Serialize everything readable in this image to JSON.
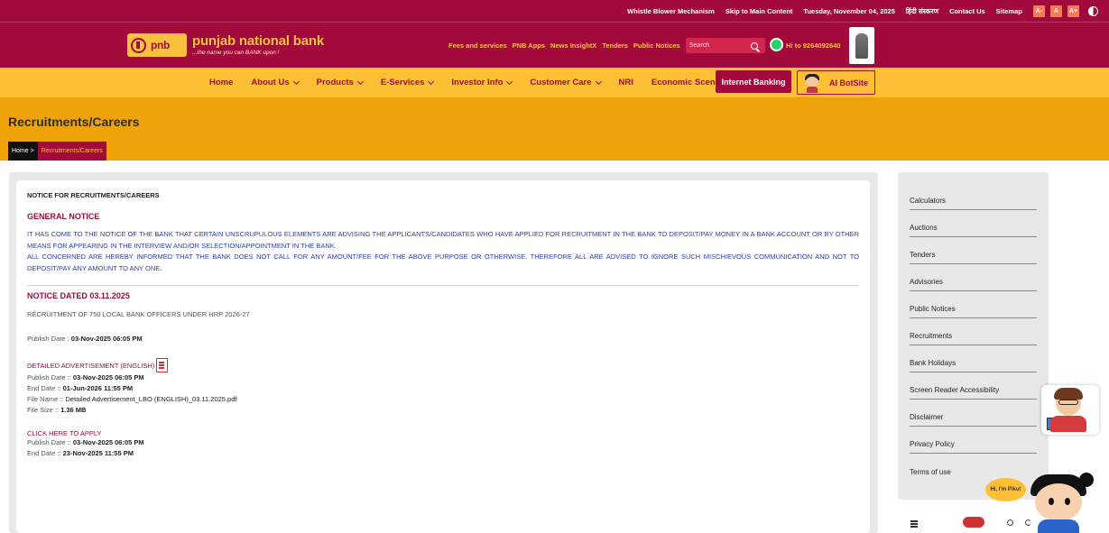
{
  "topbar": {
    "links": [
      "Whistle Blower Mechanism",
      "Skip to Main Content",
      "Tuesday, November 04, 2025",
      "हिंदी संस्करण",
      "Contact Us",
      "Sitemap"
    ],
    "font_sizes": [
      "A-",
      "A",
      "A+"
    ]
  },
  "header": {
    "logo_text": "pnb",
    "bank_name": "punjab national bank",
    "tagline": "...the name you can BANK upon !",
    "links": [
      "Fees and services",
      "PNB Apps",
      "News InsightX",
      "Tenders",
      "Public Notices"
    ],
    "search_placeholder": "Search",
    "whatsapp_text": "Hi to 9264092640"
  },
  "nav": {
    "items": [
      {
        "label": "Home",
        "dropdown": false
      },
      {
        "label": "About Us",
        "dropdown": true
      },
      {
        "label": "Products",
        "dropdown": true
      },
      {
        "label": "E-Services",
        "dropdown": true
      },
      {
        "label": "Investor Info",
        "dropdown": true
      },
      {
        "label": "Customer Care",
        "dropdown": true
      },
      {
        "label": "NRI",
        "dropdown": false
      },
      {
        "label": "Economic Scenario",
        "dropdown": false
      }
    ],
    "internet_banking": "Internet Banking",
    "ai_botsite": "AI BotSite"
  },
  "page": {
    "title": "Recruitments/Careers",
    "breadcrumb_home": "Home >",
    "breadcrumb_current": "Recruitments/Careers"
  },
  "content": {
    "notice_heading": "NOTICE FOR RECRUITMENTS/CAREERS",
    "general_title": "GENERAL NOTICE",
    "general_para1": "IT HAS COME TO THE NOTICE OF THE BANK THAT CERTAIN UNSCRUPULOUS ELEMENTS ARE ADVISING THE APPLICANTS/CANDIDATES WHO HAVE APPLIED FOR RECRUITMENT IN THE BANK TO DEPOSIT/PAY MONEY IN A BANK ACCOUNT OR BY OTHER MEANS FOR APPEARING IN THE INTERVIEW AND/OR SELECTION/APPOINTMENT IN THE BANK.",
    "general_para2": "ALL CONCERNED ARE HEREBY INFORMED THAT THE BANK DOES NOT CALL FOR ANY AMOUNT/FEE FOR THE ABOVE PURPOSE OR OTHERWISE. THEREFORE ALL ARE ADVISED TO IGNORE SUCH MISCHIEVOUS COMMUNICATION AND NOT TO DEPOSIT/PAY ANY AMOUNT TO ANY ONE.",
    "notice_dated": "NOTICE DATED 03.11.2025",
    "recruitment_title": "RECRUITMENT OF 750 LOCAL BANK OFFICERS UNDER HRP 2026-27",
    "publish_label": "Publish Date : ",
    "publish_value": "03-Nov-2025 06:05 PM",
    "advertisement": {
      "link": "DETAILED ADVERTISEMENT (ENGLISH)",
      "publish_label": "Publish Date :: ",
      "publish_value": "03-Nov-2025 06:05 PM",
      "end_label": "End Date :: ",
      "end_value": "01-Jun-2026 11:55 PM",
      "file_name_label": "File Name :: ",
      "file_name_value": "Detailed Advertisement_LBO (ENGLISH)_03.11.2025.pdf",
      "file_size_label": "File Size :: ",
      "file_size_value": "1.36 MB"
    },
    "apply": {
      "link": "CLICK HERE TO APPLY",
      "publish_label": "Publish Date :: ",
      "publish_value": "03-Nov-2025 06:05 PM",
      "end_label": "End Date :: ",
      "end_value": "23-Nov-2025 11:55 PM"
    }
  },
  "sidebar": {
    "items": [
      "Calculators",
      "Auctions",
      "Tenders",
      "Advisories",
      "Public Notices",
      "Recruitments",
      "Bank Holidays",
      "Screen Reader Accessibility",
      "Disclaimer",
      "Privacy Policy",
      "Terms of use"
    ]
  },
  "widgets": {
    "speech_bubble": "Hi, I'm Piku!"
  },
  "colors": {
    "brand_maroon": "#a20a3c",
    "brand_yellow": "#fdbf33",
    "title_band": "#efa30b",
    "notice_blue": "#2b3fb5"
  }
}
